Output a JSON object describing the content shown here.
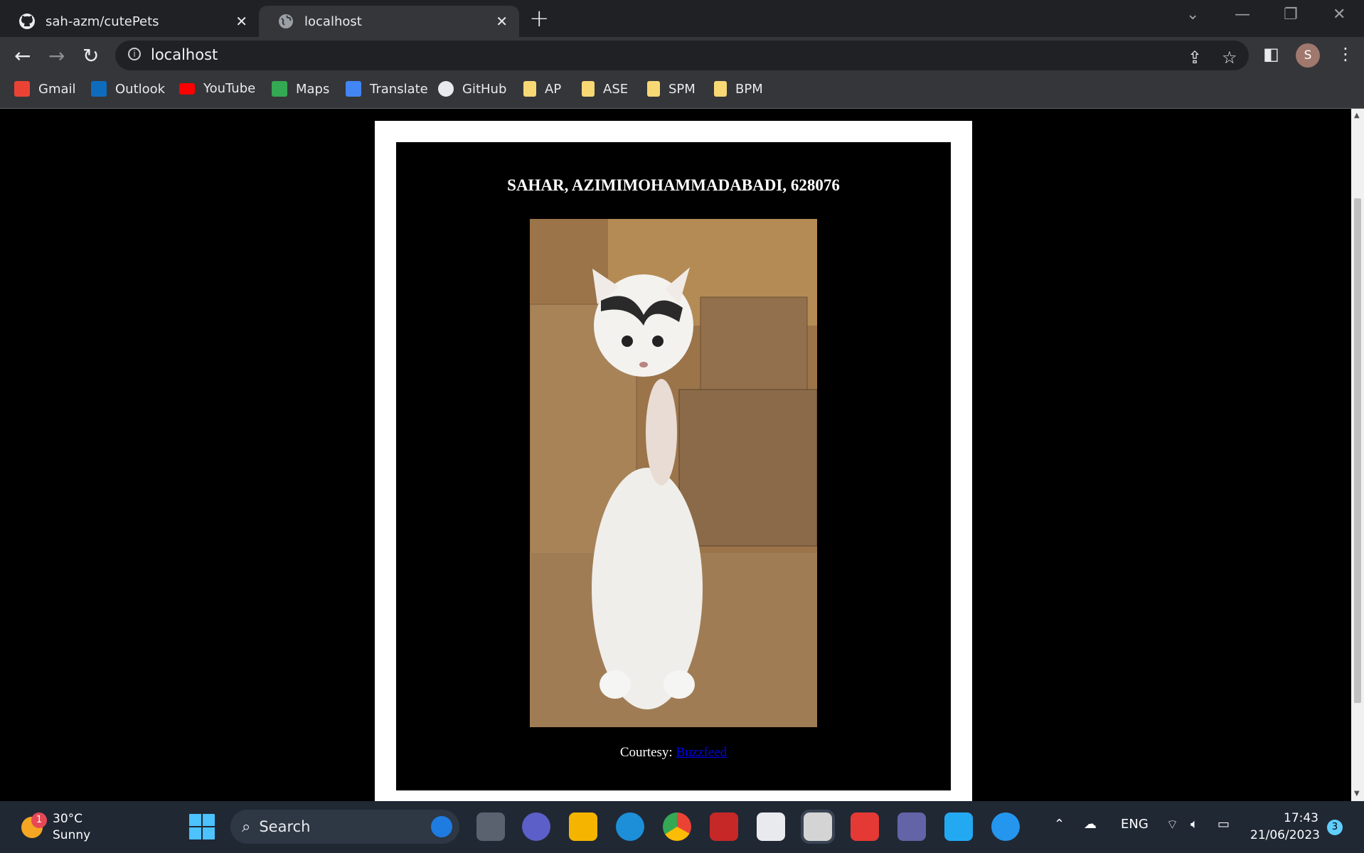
{
  "browser": {
    "tabs": [
      {
        "title": "sah-azm/cutePets",
        "active": false
      },
      {
        "title": "localhost",
        "active": true
      }
    ],
    "url": "localhost",
    "profile_initial": "S",
    "bookmarks": [
      "Gmail",
      "Outlook",
      "YouTube",
      "Maps",
      "Translate",
      "GitHub",
      "AP",
      "ASE",
      "SPM",
      "BPM"
    ]
  },
  "page": {
    "heading": "SAHAR, AZIMIMOHAMMADABADI, 628076",
    "courtesy_label": "Courtesy:",
    "courtesy_link": "Buzzfeed"
  },
  "taskbar": {
    "weather_temp": "30°C",
    "weather_desc": "Sunny",
    "weather_badge": "1",
    "search_label": "Search",
    "language": "ENG",
    "time": "17:43",
    "date": "21/06/2023",
    "notification_count": "3"
  }
}
